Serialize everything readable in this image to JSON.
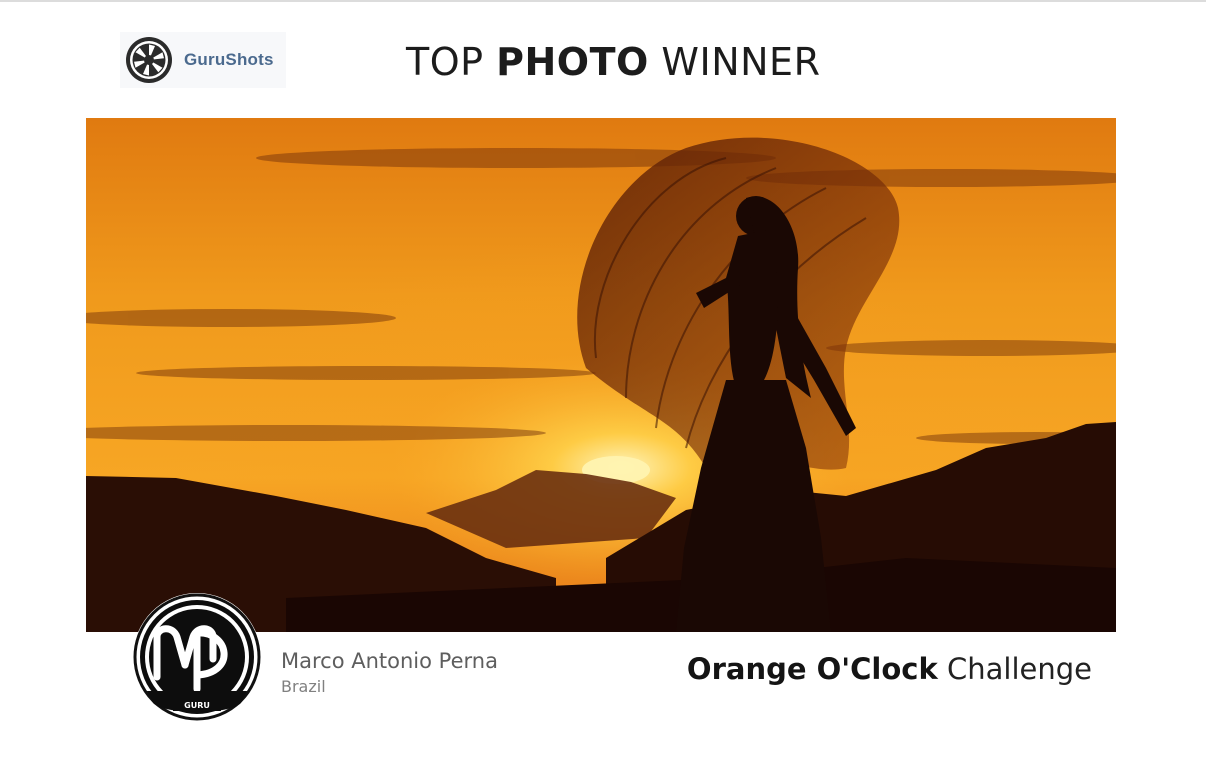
{
  "logo": {
    "text": "GuruShots",
    "icon": "camera-aperture-icon"
  },
  "heading": {
    "prefix": "TOP",
    "emphasis": "PHOTO",
    "suffix": "WINNER"
  },
  "photo": {
    "subject": "winning-photo",
    "colors": {
      "sky_top": "#e8881c",
      "sun": "#fff3b0",
      "silhouette": "#1a0804"
    }
  },
  "author": {
    "name": "Marco Antonio Perna",
    "country": "Brazil",
    "avatar_badge": "GURU",
    "avatar_icon": "mp-monogram-logo"
  },
  "challenge": {
    "name": "Orange O'Clock",
    "suffix": "Challenge"
  }
}
